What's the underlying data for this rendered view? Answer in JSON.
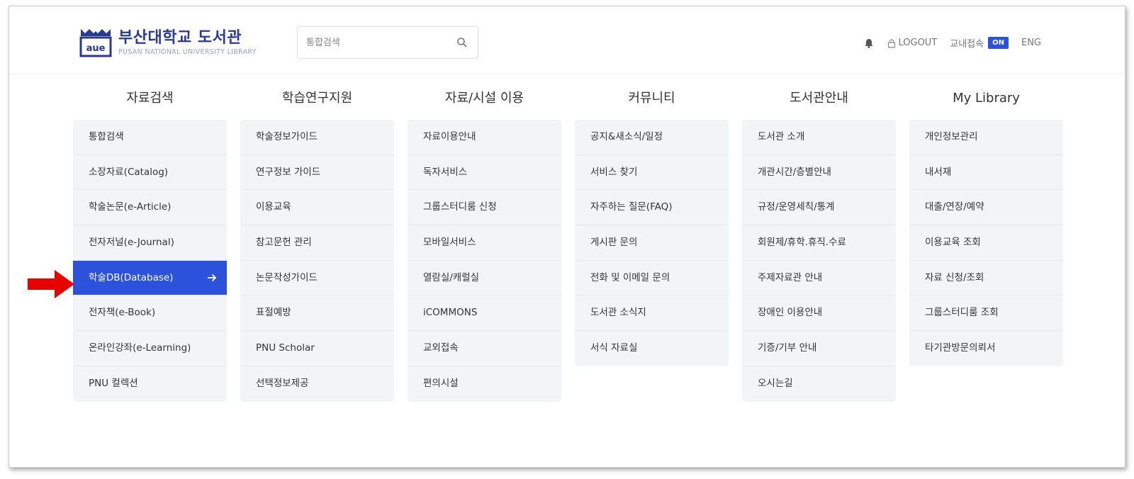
{
  "header": {
    "logo_title": "부산대학교 도서관",
    "logo_subtitle": "PUSAN NATIONAL UNIVERSITY LIBRARY",
    "search_placeholder": "통합검색",
    "logout_label": "LOGOUT",
    "campus_access_label": "교내접속",
    "campus_access_status": "ON",
    "language_label": "ENG"
  },
  "menu": [
    {
      "title": "자료검색",
      "items": [
        "통합검색",
        "소장자료(Catalog)",
        "학술논문(e-Article)",
        "전자저널(e-Journal)",
        "학술DB(Database)",
        "전자책(e-Book)",
        "온라인강좌(e-Learning)",
        "PNU 컬렉션"
      ]
    },
    {
      "title": "학습연구지원",
      "items": [
        "학술정보가이드",
        "연구정보 가이드",
        "이용교육",
        "참고문헌 관리",
        "논문작성가이드",
        "표절예방",
        "PNU Scholar",
        "선택정보제공"
      ]
    },
    {
      "title": "자료/시설 이용",
      "items": [
        "자료이용안내",
        "독자서비스",
        "그룹스터디룸 신청",
        "모바일서비스",
        "열람실/캐럴실",
        "iCOMMONS",
        "교외접속",
        "편의시설"
      ]
    },
    {
      "title": "커뮤니티",
      "items": [
        "공지&새소식/일정",
        "서비스 찾기",
        "자주하는 질문(FAQ)",
        "게시판 문의",
        "전화 및 이메일 문의",
        "도서관 소식지",
        "서식 자료실"
      ]
    },
    {
      "title": "도서관안내",
      "items": [
        "도서관 소개",
        "개관시간/층별안내",
        "규정/운영세칙/통계",
        "회원제/휴학.휴직.수료",
        "주제자료관 안내",
        "장애인 이용안내",
        "기증/기부 안내",
        "오시는길"
      ]
    },
    {
      "title": "My Library",
      "items": [
        "개인정보관리",
        "내서재",
        "대출/연장/예약",
        "이용교육 조회",
        "자료 신청/조회",
        "그룹스터디룸 조회",
        "타기관방문의뢰서"
      ]
    }
  ],
  "active_item": "학술DB(Database)",
  "colors": {
    "accent": "#2c52dc",
    "menu_bg": "#f3f4f6",
    "annotation_arrow": "#e60000",
    "logo": "#2a3a8f"
  },
  "icons": [
    "logo-mark-icon",
    "search-icon",
    "bell-icon",
    "lock-icon",
    "arrow-right-icon",
    "red-annotation-arrow"
  ]
}
